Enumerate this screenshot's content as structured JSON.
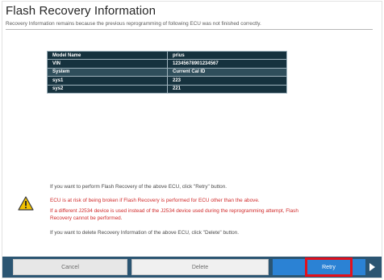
{
  "header": {
    "title": "Flash Recovery Information",
    "subtitle": "Recovery Information remains because the previous reprogramming of following ECU was not finished correctly."
  },
  "table": {
    "rows": [
      {
        "label": "Model Name",
        "value": "prius"
      },
      {
        "label": "VIN",
        "value": "12345678901234567"
      },
      {
        "label": "System",
        "value": "Current Cal ID"
      },
      {
        "label": "sys1",
        "value": "223"
      },
      {
        "label": "sys2",
        "value": "221"
      }
    ]
  },
  "messages": {
    "retry_hint": "If you want to perform Flash Recovery of the above ECU, click \"Retry\" button.",
    "warning1": "ECU is at risk of being broken if Flash Recovery is performed for ECU other than the above.",
    "warning2_line1": "If a different J2534 device is used instead of the J2534 device used during the reprogramming attempt, Flash",
    "warning2_line2": "Recovery cannot be performed.",
    "delete_hint": "If you want to delete Recovery Information of the above ECU, click \"Delete\" button."
  },
  "footer": {
    "cancel_label": "Cancel",
    "delete_label": "Delete",
    "retry_label": "Retry"
  },
  "colors": {
    "table_dark": "#16323e",
    "table_light": "#2f4e5b",
    "warning_text": "#d02a2a",
    "footer_bar": "#2b5572",
    "retry_button": "#2b82d4",
    "highlight_box": "#e3101b"
  },
  "icons": {
    "warning": "warning-triangle-icon",
    "next": "next-arrow-icon"
  }
}
